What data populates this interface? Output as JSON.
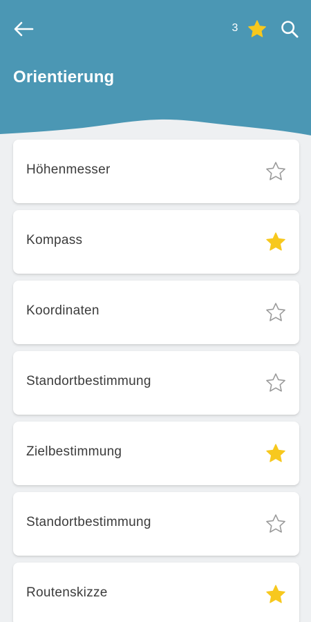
{
  "header": {
    "title": "Orientierung",
    "favorite_count": "3",
    "background_color": "#4b97b4",
    "back_icon": "arrow-left-icon",
    "favorites_icon": "star-filled-icon",
    "search_icon": "search-icon"
  },
  "colors": {
    "star_filled": "#f7c81e",
    "star_outline": "#9a9a9a",
    "card_background": "#ffffff",
    "page_background": "#eef0f2"
  },
  "items": [
    {
      "label": "Höhenmesser",
      "favorite": false
    },
    {
      "label": "Kompass",
      "favorite": true
    },
    {
      "label": "Koordinaten",
      "favorite": false
    },
    {
      "label": "Standortbestimmung",
      "favorite": false
    },
    {
      "label": "Zielbestimmung",
      "favorite": true
    },
    {
      "label": "Standortbestimmung",
      "favorite": false
    },
    {
      "label": "Routenskizze",
      "favorite": true
    }
  ]
}
